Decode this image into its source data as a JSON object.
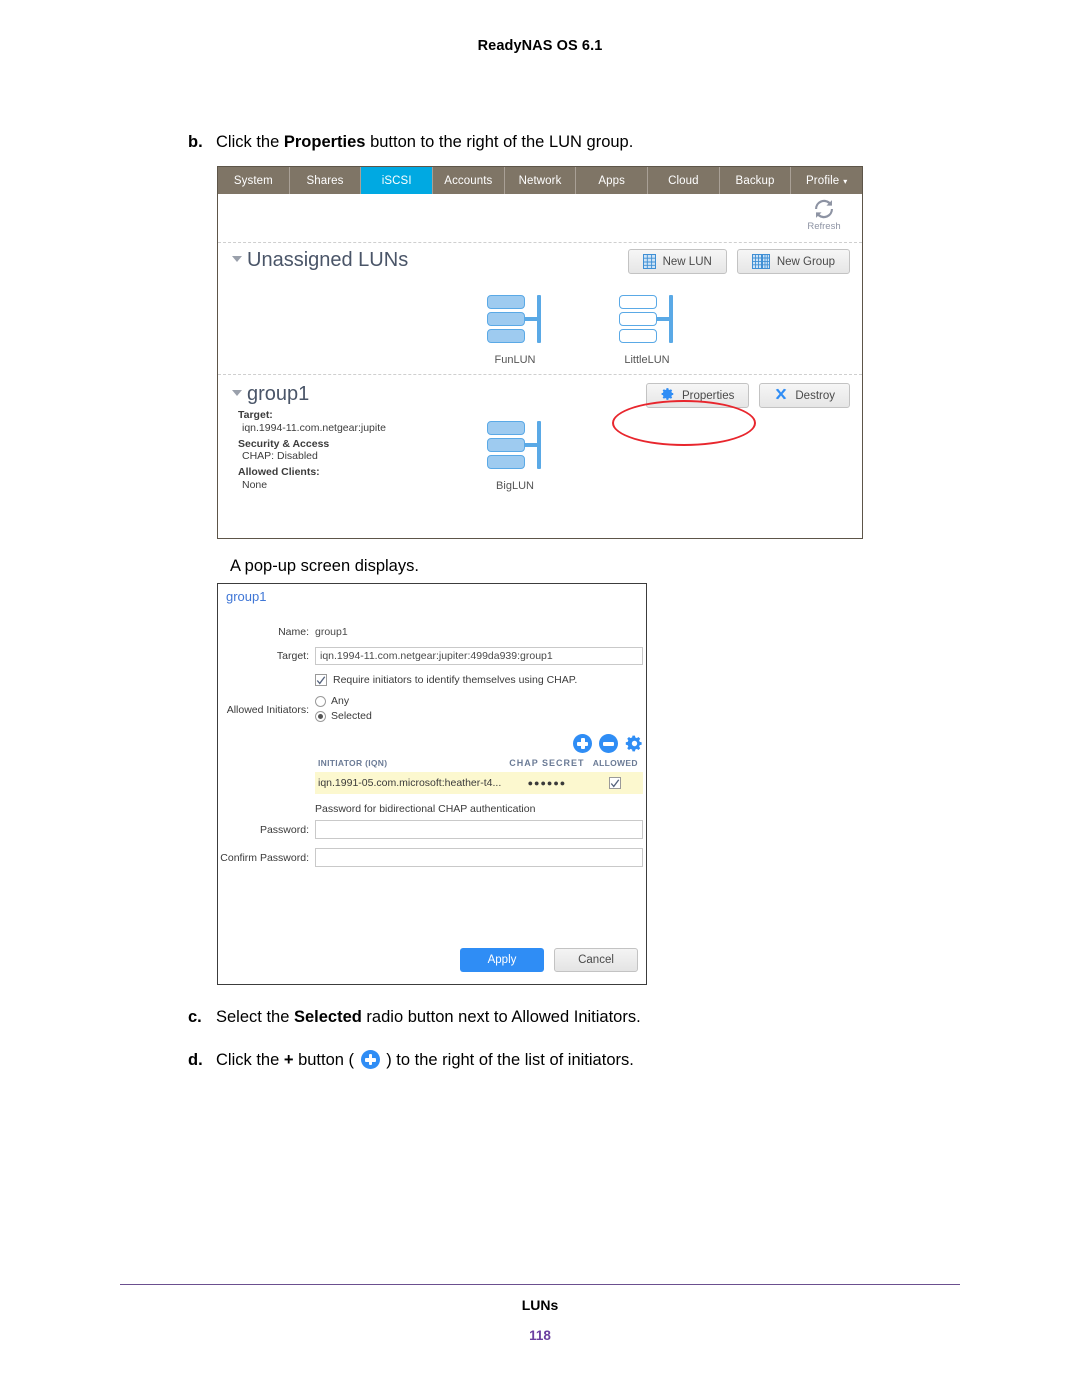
{
  "document": {
    "header": "ReadyNAS OS 6.1",
    "footer_title": "LUNs",
    "page_number": "118"
  },
  "steps": {
    "b": {
      "marker": "b.",
      "text_before": "Click the ",
      "bold": "Properties",
      "text_after": " button to the right of the LUN group."
    },
    "note": "A pop-up screen displays.",
    "c": {
      "marker": "c.",
      "text_before": "Select the ",
      "bold": "Selected",
      "text_after": " radio button next to Allowed Initiators."
    },
    "d": {
      "marker": "d.",
      "text_before": "Click the ",
      "bold": "+",
      "text_mid": " button ( ",
      "text_after": " ) to the right of the list of initiators."
    }
  },
  "screenshot_iscsi": {
    "tabs": [
      {
        "label": "System",
        "active": false
      },
      {
        "label": "Shares",
        "active": false
      },
      {
        "label": "iSCSI",
        "active": true
      },
      {
        "label": "Accounts",
        "active": false
      },
      {
        "label": "Network",
        "active": false
      },
      {
        "label": "Apps",
        "active": false
      },
      {
        "label": "Cloud",
        "active": false
      },
      {
        "label": "Backup",
        "active": false
      },
      {
        "label": "Profile",
        "active": false,
        "caret": "▾"
      }
    ],
    "refresh_label": "Refresh",
    "unassigned": {
      "title": "Unassigned LUNs",
      "buttons": [
        {
          "label": "New LUN",
          "icon": "single-grid-icon"
        },
        {
          "label": "New Group",
          "icon": "multi-grid-icon"
        }
      ],
      "luns": [
        {
          "label": "FunLUN",
          "filled": true
        },
        {
          "label": "LittleLUN",
          "filled": false
        }
      ]
    },
    "group": {
      "title": "group1",
      "buttons": [
        {
          "label": "Properties",
          "icon": "gear-icon",
          "highlighted": true
        },
        {
          "label": "Destroy",
          "icon": "x-icon",
          "highlighted": false
        }
      ],
      "meta": [
        {
          "key": "Target:",
          "value": "iqn.1994-11.com.netgear:jupite"
        },
        {
          "key": "Security & Access",
          "value": "CHAP: Disabled"
        },
        {
          "key": "Allowed Clients:",
          "value": "None"
        }
      ],
      "luns": [
        {
          "label": "BigLUN",
          "filled": true
        }
      ]
    },
    "highlight_color": "#e8262d",
    "accent_color": "#00a9e2",
    "tabbar_color": "#7f7566"
  },
  "screenshot_dialog": {
    "title": "group1",
    "name_label": "Name:",
    "name_value": "group1",
    "target_label": "Target:",
    "target_value": "iqn.1994-11.com.netgear:jupiter:499da939:group1",
    "chap_checkbox": {
      "label": "Require initiators to identify themselves using CHAP.",
      "checked": true
    },
    "allowed_initiators_label": "Allowed Initiators:",
    "initiator_options": [
      {
        "label": "Any",
        "selected": false
      },
      {
        "label": "Selected",
        "selected": true
      }
    ],
    "action_icons": [
      {
        "name": "add-icon",
        "glyph": "+"
      },
      {
        "name": "remove-icon",
        "glyph": "−"
      },
      {
        "name": "settings-gear-icon",
        "glyph": "gear"
      }
    ],
    "table": {
      "columns": [
        "INITIATOR (IQN)",
        "CHAP SECRET",
        "ALLOWED"
      ],
      "rows": [
        {
          "iqn": "iqn.1991-05.com.microsoft:heather-t4...",
          "chap_secret": "●●●●●●",
          "allowed": true
        }
      ],
      "row_highlight_color": "#fcf8cf"
    },
    "bidirectional_note": "Password for bidirectional CHAP authentication",
    "password_label": "Password:",
    "password_value": "",
    "confirm_password_label": "Confirm Password:",
    "confirm_password_value": "",
    "apply_label": "Apply",
    "cancel_label": "Cancel",
    "primary_color": "#2f8df5"
  }
}
